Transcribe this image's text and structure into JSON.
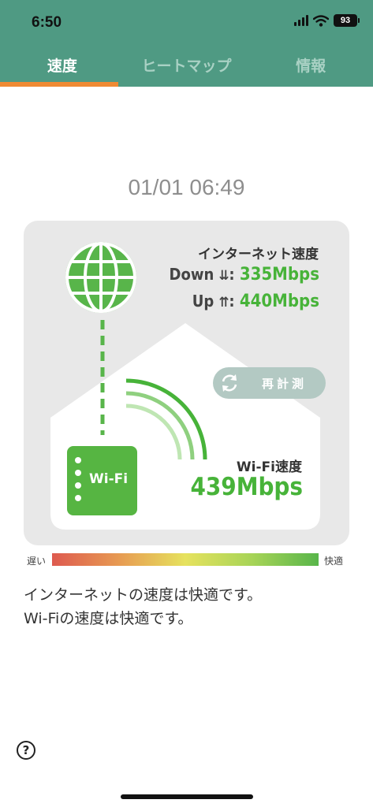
{
  "status_bar": {
    "time": "6:50",
    "battery": "93",
    "icons": [
      "signal-icon",
      "wifi-icon",
      "battery-icon"
    ]
  },
  "tabs": [
    {
      "label": "速度",
      "active": true
    },
    {
      "label": "ヒートマップ",
      "active": false
    },
    {
      "label": "情報",
      "active": false
    }
  ],
  "timestamp": "01/01 06:49",
  "internet": {
    "title": "インターネット速度",
    "down_label": "Down",
    "down_arrow": "⇊",
    "down_value": "335Mbps",
    "up_label": "Up",
    "up_arrow": "⇈",
    "up_value": "440Mbps"
  },
  "remeasure_button": {
    "label": "再計測",
    "icon": "refresh-icon"
  },
  "wifi": {
    "device_label": "Wi-Fi",
    "title": "Wi-Fi速度",
    "value": "439Mbps"
  },
  "scale": {
    "slow": "遅い",
    "fast": "快適"
  },
  "messages": [
    "インターネットの速度は快適です。",
    "Wi-Fiの速度は快適です。"
  ],
  "help_icon": "?",
  "colors": {
    "header": "#4f9a83",
    "tab_indicator": "#ef8a33",
    "accent_green": "#47b339",
    "card_bg": "#e8e8e8",
    "button_bg": "#b3c9c3"
  }
}
